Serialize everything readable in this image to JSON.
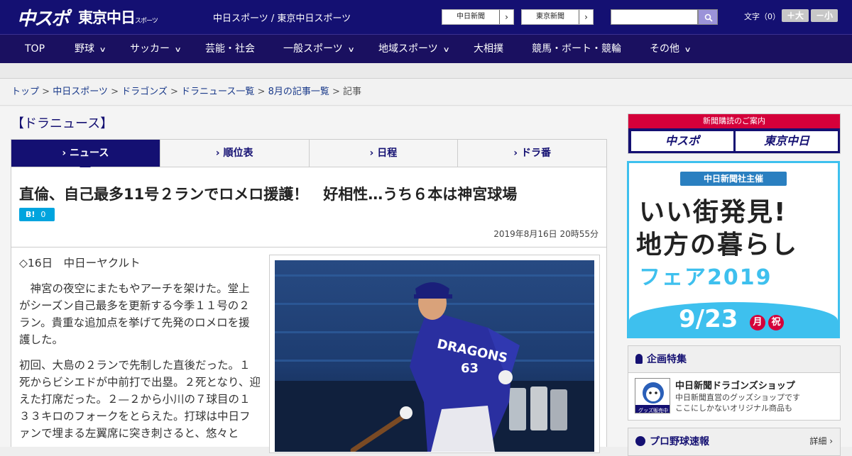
{
  "header": {
    "logo_chuspo": "中スポ",
    "logo_tokyo": "東京中日",
    "logo_tokyo_sub": "スポーツ",
    "site_names": "中日スポーツ / 東京中日スポーツ",
    "paper_buttons": [
      {
        "label": "中日新聞",
        "arrow": "›"
      },
      {
        "label": "東京新聞",
        "arrow": "›"
      }
    ],
    "fontsize_label": "文字（0）",
    "fontsize_larger": "＋大",
    "fontsize_smaller": "－小"
  },
  "nav": {
    "items": [
      {
        "label": "TOP",
        "chevron": ""
      },
      {
        "label": "野球",
        "chevron": "∨"
      },
      {
        "label": "サッカー",
        "chevron": "∨"
      },
      {
        "label": "芸能・社会",
        "chevron": ""
      },
      {
        "label": "一般スポーツ",
        "chevron": "∨"
      },
      {
        "label": "地域スポーツ",
        "chevron": "∨"
      },
      {
        "label": "大相撲",
        "chevron": ""
      },
      {
        "label": "競馬・ボート・競輪",
        "chevron": ""
      },
      {
        "label": "その他",
        "chevron": "∨"
      }
    ]
  },
  "breadcrumb": {
    "items": [
      "トップ",
      "中日スポーツ",
      "ドラゴンズ",
      "ドラニュース一覧",
      "8月の記事一覧"
    ],
    "separator": " > ",
    "current": "記事"
  },
  "main": {
    "section_title": "【ドラニュース】",
    "tabs": [
      {
        "label": "› ニュース",
        "active": true
      },
      {
        "label": "› 順位表",
        "active": false
      },
      {
        "label": "› 日程",
        "active": false
      },
      {
        "label": "› ドラ番",
        "active": false
      }
    ],
    "headline": "直倫、自己最多11号２ランでロメロ援護！　好相性…うち６本は神宮球場",
    "hatena_label": "B!",
    "hatena_count": "0",
    "date": "2019年8月16日 20時55分",
    "body": [
      "◇16日　中日ーヤクルト",
      "　神宮の夜空にまたもやアーチを架けた。堂上がシーズン自己最多を更新する今季１１号の２ラン。貴重な追加点を挙げて先発のロメロを援護した。",
      "初回、大島の２ランで先制した直後だった。１死からビシエドが中前打で出塁。２死となり、迎えた打席だった。２—２から小川の７球目の１３３キロのフォークをとらえた。打球は中日ファンで埋まる左翼席に突き刺さると、悠々と"
    ],
    "photo_jersey_text": "DRAGONS",
    "photo_number": "63"
  },
  "sidebar": {
    "subscription_title": "新聞購読のご案内",
    "sub_left": "中スポ",
    "sub_right": "東京中日",
    "fair_tag": "中日新聞社主催",
    "fair_line1": "いい街発見!",
    "fair_line2": "地方の暮らし",
    "fair_line3": "フェア2019",
    "fair_date": "9/23",
    "fair_day1": "月",
    "fair_day2": "祝",
    "feature_title": "企画特集",
    "shop_img_text": "グッズ販売中",
    "shop_title": "中日新聞ドラゴンズショップ",
    "shop_desc1": "中日新聞直営のグッズショップです",
    "shop_desc2": "ここにしかないオリジナル商品も",
    "pro_title": "プロ野球速報",
    "pro_detail": "詳細 ›"
  }
}
